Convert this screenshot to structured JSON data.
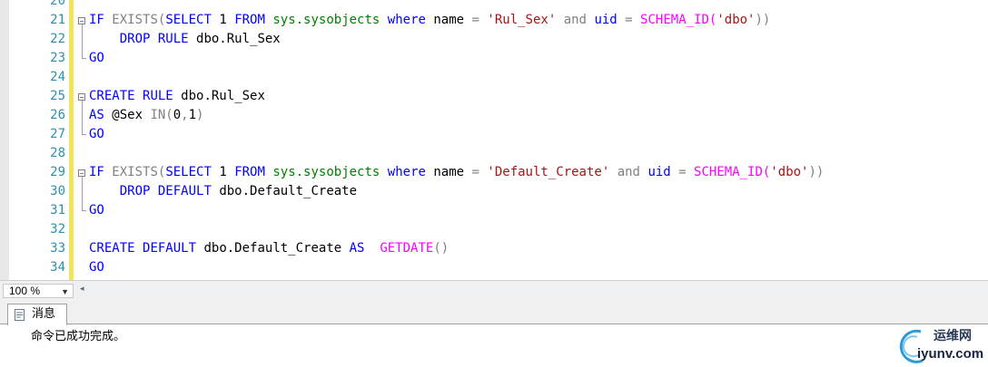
{
  "editor": {
    "lines": [
      {
        "num": "20",
        "tokens": []
      },
      {
        "num": "21",
        "tokens": [
          {
            "t": "IF",
            "c": "kw"
          },
          {
            "t": " "
          },
          {
            "t": "EXISTS(",
            "c": "gray"
          },
          {
            "t": "SELECT",
            "c": "kw"
          },
          {
            "t": " 1 "
          },
          {
            "t": "FROM",
            "c": "kw"
          },
          {
            "t": " "
          },
          {
            "t": "sys.sysobjects",
            "c": "sys"
          },
          {
            "t": " "
          },
          {
            "t": "where",
            "c": "kw"
          },
          {
            "t": " name "
          },
          {
            "t": "=",
            "c": "gray"
          },
          {
            "t": " "
          },
          {
            "t": "'Rul_Sex'",
            "c": "str"
          },
          {
            "t": " "
          },
          {
            "t": "and",
            "c": "gray"
          },
          {
            "t": " "
          },
          {
            "t": "uid",
            "c": "kw"
          },
          {
            "t": " "
          },
          {
            "t": "=",
            "c": "gray"
          },
          {
            "t": " "
          },
          {
            "t": "SCHEMA_ID(",
            "c": "fn"
          },
          {
            "t": "'dbo'",
            "c": "str"
          },
          {
            "t": "))",
            "c": "gray"
          }
        ]
      },
      {
        "num": "22",
        "tokens": [
          {
            "t": "    "
          },
          {
            "t": "DROP",
            "c": "kw"
          },
          {
            "t": " "
          },
          {
            "t": "RULE",
            "c": "kw"
          },
          {
            "t": " dbo.Rul_Sex"
          }
        ]
      },
      {
        "num": "23",
        "tokens": [
          {
            "t": "GO",
            "c": "kw"
          }
        ]
      },
      {
        "num": "24",
        "tokens": []
      },
      {
        "num": "25",
        "tokens": [
          {
            "t": "CREATE",
            "c": "kw"
          },
          {
            "t": " "
          },
          {
            "t": "RULE",
            "c": "kw"
          },
          {
            "t": " dbo.Rul_Sex"
          }
        ]
      },
      {
        "num": "26",
        "tokens": [
          {
            "t": "AS",
            "c": "kw"
          },
          {
            "t": " @Sex "
          },
          {
            "t": "IN",
            "c": "gray"
          },
          {
            "t": "(",
            "c": "gray"
          },
          {
            "t": "0"
          },
          {
            "t": ",",
            "c": "gray"
          },
          {
            "t": "1"
          },
          {
            "t": ")",
            "c": "gray"
          }
        ]
      },
      {
        "num": "27",
        "tokens": [
          {
            "t": "GO",
            "c": "kw"
          }
        ]
      },
      {
        "num": "28",
        "tokens": []
      },
      {
        "num": "29",
        "tokens": [
          {
            "t": "IF",
            "c": "kw"
          },
          {
            "t": " "
          },
          {
            "t": "EXISTS(",
            "c": "gray"
          },
          {
            "t": "SELECT",
            "c": "kw"
          },
          {
            "t": " 1 "
          },
          {
            "t": "FROM",
            "c": "kw"
          },
          {
            "t": " "
          },
          {
            "t": "sys.sysobjects",
            "c": "sys"
          },
          {
            "t": " "
          },
          {
            "t": "where",
            "c": "kw"
          },
          {
            "t": " name "
          },
          {
            "t": "=",
            "c": "gray"
          },
          {
            "t": " "
          },
          {
            "t": "'Default_Create'",
            "c": "str"
          },
          {
            "t": " "
          },
          {
            "t": "and",
            "c": "gray"
          },
          {
            "t": " "
          },
          {
            "t": "uid",
            "c": "kw"
          },
          {
            "t": " "
          },
          {
            "t": "=",
            "c": "gray"
          },
          {
            "t": " "
          },
          {
            "t": "SCHEMA_ID(",
            "c": "fn"
          },
          {
            "t": "'dbo'",
            "c": "str"
          },
          {
            "t": "))",
            "c": "gray"
          }
        ]
      },
      {
        "num": "30",
        "tokens": [
          {
            "t": "    "
          },
          {
            "t": "DROP",
            "c": "kw"
          },
          {
            "t": " "
          },
          {
            "t": "DEFAULT",
            "c": "kw"
          },
          {
            "t": " dbo.Default_Create"
          }
        ]
      },
      {
        "num": "31",
        "tokens": [
          {
            "t": "GO",
            "c": "kw"
          }
        ]
      },
      {
        "num": "32",
        "tokens": []
      },
      {
        "num": "33",
        "tokens": [
          {
            "t": "CREATE",
            "c": "kw"
          },
          {
            "t": " "
          },
          {
            "t": "DEFAULT",
            "c": "kw"
          },
          {
            "t": " dbo.Default_Create "
          },
          {
            "t": "AS",
            "c": "kw"
          },
          {
            "t": "  "
          },
          {
            "t": "GETDATE",
            "c": "fn"
          },
          {
            "t": "()",
            "c": "gray"
          }
        ]
      },
      {
        "num": "34",
        "tokens": [
          {
            "t": "GO",
            "c": "kw"
          }
        ]
      }
    ]
  },
  "statusbar": {
    "zoom": "100 %"
  },
  "results": {
    "tab_label": "消息",
    "message": "命令已成功完成。"
  },
  "watermark": {
    "line1": "运维网",
    "line2": "iyunv.com"
  },
  "colors": {
    "keyword": "#0000ff",
    "string": "#a31515",
    "function": "#ff00ff",
    "system": "#008000",
    "operator": "#808080",
    "line_number": "#2b91af",
    "change_bar": "#f2e55a"
  }
}
